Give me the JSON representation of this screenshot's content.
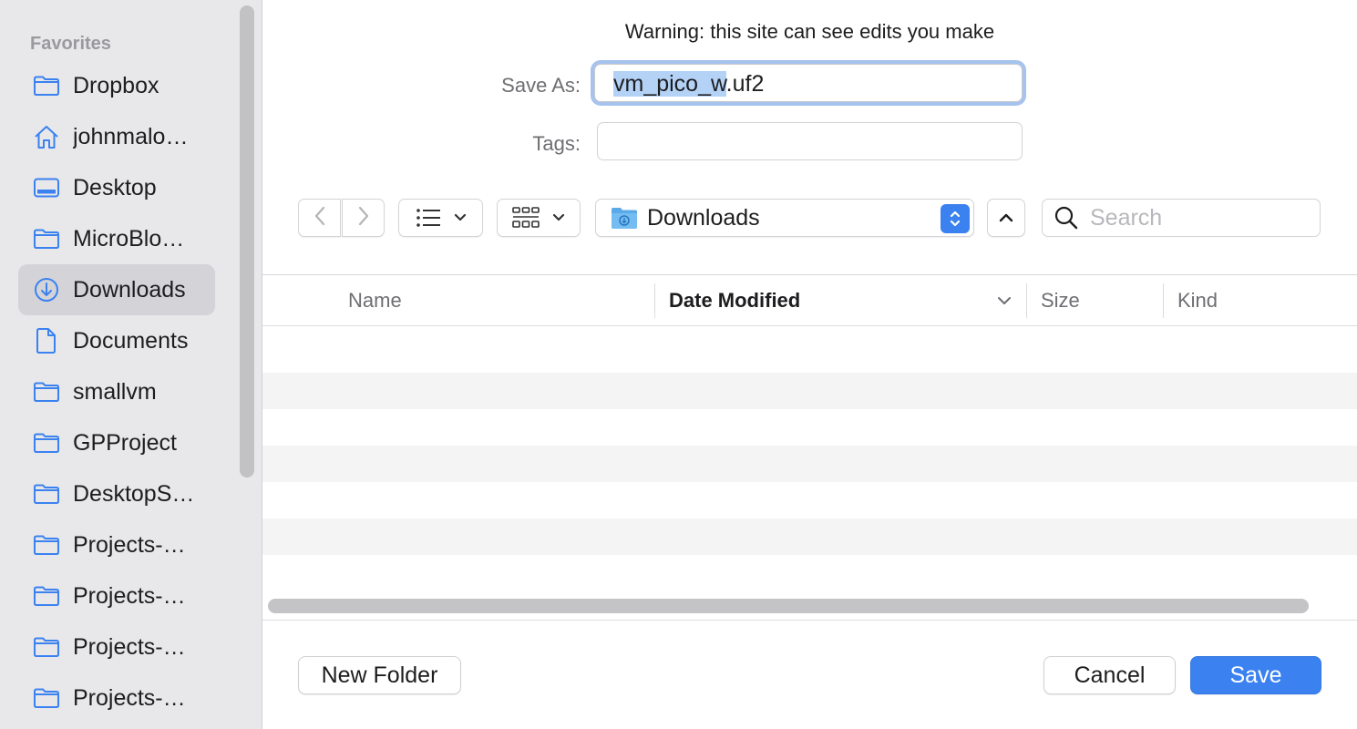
{
  "sidebar": {
    "section_title": "Favorites",
    "items": [
      {
        "label": "Dropbox",
        "icon": "folder-icon"
      },
      {
        "label": "johnmalo…",
        "icon": "home-icon"
      },
      {
        "label": "Desktop",
        "icon": "desktop-icon"
      },
      {
        "label": "MicroBlo…",
        "icon": "folder-icon"
      },
      {
        "label": "Downloads",
        "icon": "downloads-icon",
        "selected": true
      },
      {
        "label": "Documents",
        "icon": "document-icon"
      },
      {
        "label": "smallvm",
        "icon": "folder-icon"
      },
      {
        "label": "GPProject",
        "icon": "folder-icon"
      },
      {
        "label": "DesktopS…",
        "icon": "folder-icon"
      },
      {
        "label": "Projects-…",
        "icon": "folder-icon"
      },
      {
        "label": "Projects-…",
        "icon": "folder-icon"
      },
      {
        "label": "Projects-…",
        "icon": "folder-icon"
      },
      {
        "label": "Projects-…",
        "icon": "folder-icon"
      }
    ]
  },
  "dialog": {
    "warning": "Warning: this site can see edits you make",
    "save_as_label": "Save As:",
    "filename_selected": "vm_pico_w",
    "filename_extension": ".uf2",
    "tags_label": "Tags:",
    "tags_value": "",
    "location": "Downloads",
    "search_placeholder": "Search"
  },
  "columns": {
    "name": "Name",
    "date_modified": "Date Modified",
    "size": "Size",
    "kind": "Kind",
    "sorted_by": "Date Modified"
  },
  "buttons": {
    "new_folder": "New Folder",
    "cancel": "Cancel",
    "save": "Save"
  },
  "colors": {
    "accent": "#3b82f0",
    "selection": "#b3d2f6",
    "sidebar_bg": "#e8e8ea"
  }
}
